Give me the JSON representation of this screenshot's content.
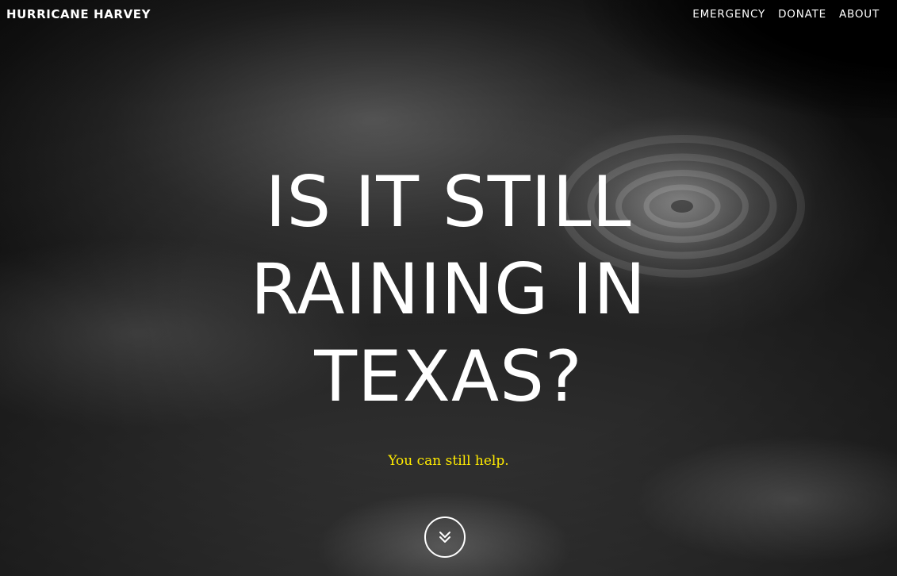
{
  "header": {
    "brand": "HURRICANE HARVEY",
    "nav": [
      {
        "label": "EMERGENCY"
      },
      {
        "label": "DONATE"
      },
      {
        "label": "ABOUT"
      }
    ]
  },
  "hero": {
    "headline_lines": [
      "IS IT STILL",
      "RAINING IN",
      "TEXAS?"
    ],
    "subtitle": "You can still help.",
    "scroll_icon": "double-chevron-down-icon"
  },
  "colors": {
    "accent": "#ffea00",
    "text": "#ffffff",
    "background": "#1c1c1c"
  }
}
